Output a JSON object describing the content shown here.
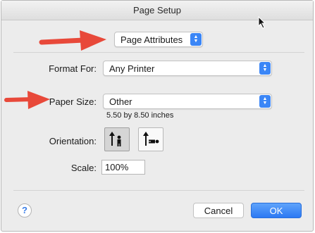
{
  "window": {
    "title": "Page Setup"
  },
  "settings_menu": {
    "value": "Page Attributes"
  },
  "format_for": {
    "label": "Format For:",
    "value": "Any Printer"
  },
  "paper_size": {
    "label": "Paper Size:",
    "value": "Other",
    "dimensions": "5.50 by 8.50 inches"
  },
  "orientation": {
    "label": "Orientation:",
    "selected": "portrait"
  },
  "scale": {
    "label": "Scale:",
    "value": "100%"
  },
  "buttons": {
    "help": "?",
    "cancel": "Cancel",
    "ok": "OK"
  },
  "colors": {
    "accent": "#3b86f6",
    "annotation_arrow": "#e8493a"
  }
}
